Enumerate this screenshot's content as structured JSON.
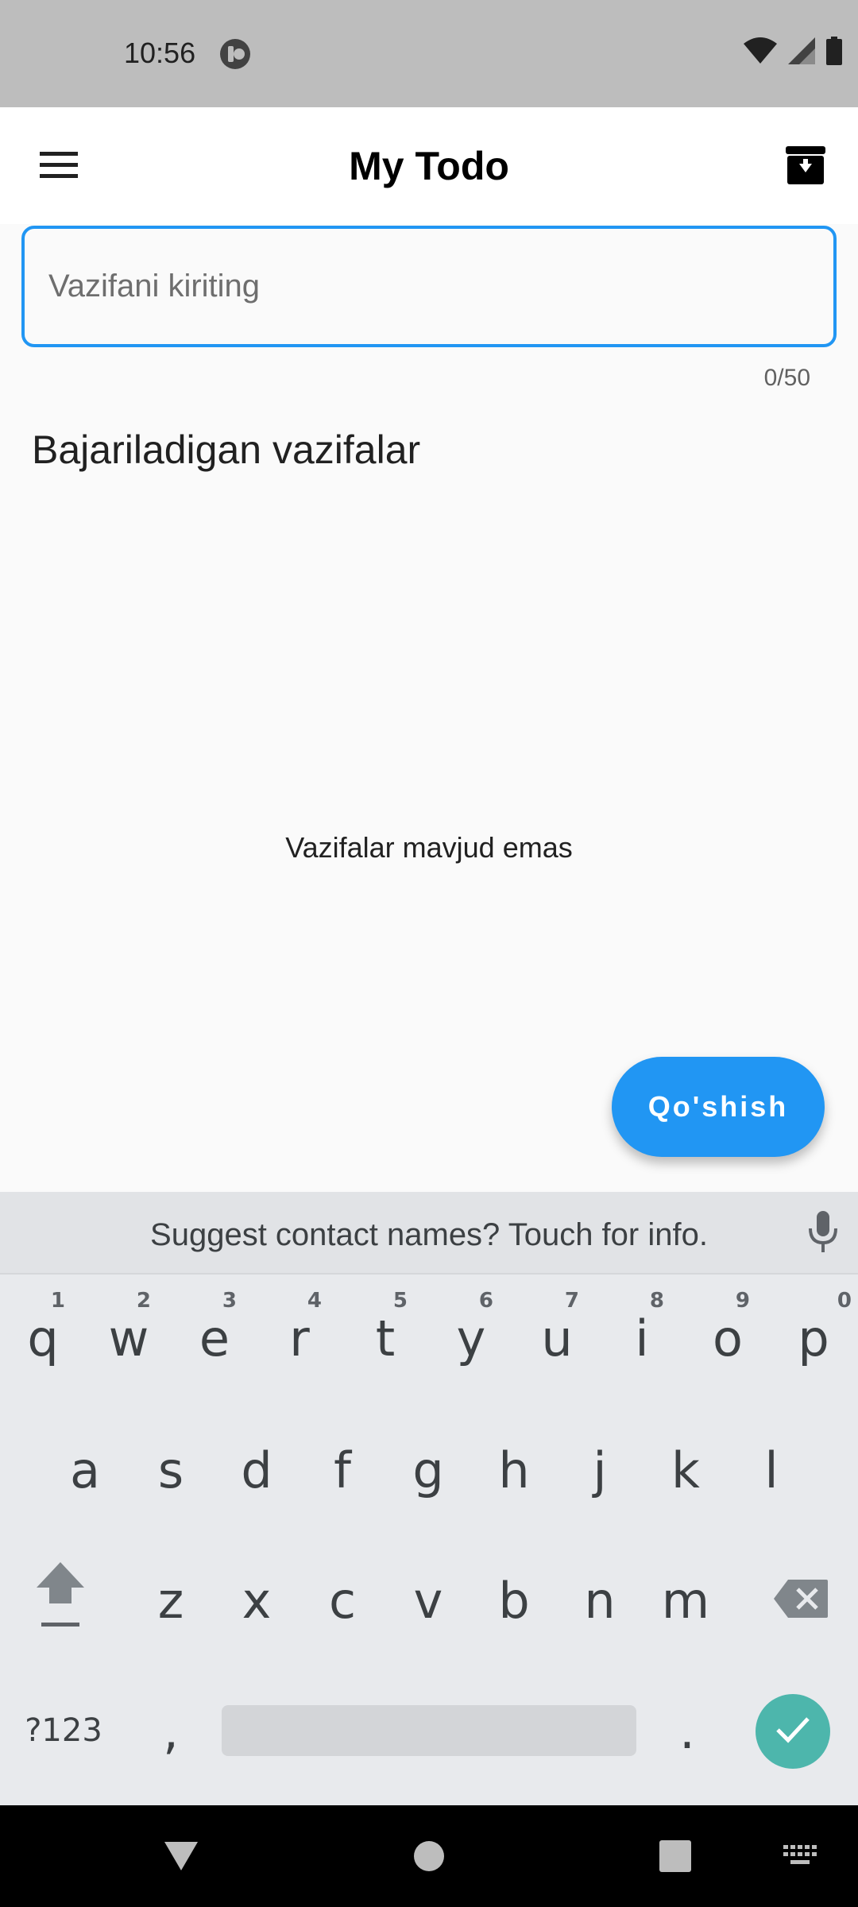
{
  "status_bar": {
    "time": "10:56"
  },
  "app_bar": {
    "title": "My Todo",
    "menu_icon": "menu-icon",
    "archive_icon": "archive-icon"
  },
  "task_input": {
    "placeholder": "Vazifani kiriting",
    "value": "",
    "counter": "0/50"
  },
  "section": {
    "title": "Bajariladigan vazifalar"
  },
  "empty_state": {
    "message": "Vazifalar mavjud emas"
  },
  "fab": {
    "label": "Qo'shish",
    "color": "#2196f3"
  },
  "keyboard": {
    "suggestion": "Suggest contact names? Touch for info.",
    "row1": [
      {
        "key": "q",
        "hint": "1"
      },
      {
        "key": "w",
        "hint": "2"
      },
      {
        "key": "e",
        "hint": "3"
      },
      {
        "key": "r",
        "hint": "4"
      },
      {
        "key": "t",
        "hint": "5"
      },
      {
        "key": "y",
        "hint": "6"
      },
      {
        "key": "u",
        "hint": "7"
      },
      {
        "key": "i",
        "hint": "8"
      },
      {
        "key": "o",
        "hint": "9"
      },
      {
        "key": "p",
        "hint": "0"
      }
    ],
    "row2": [
      "a",
      "s",
      "d",
      "f",
      "g",
      "h",
      "j",
      "k",
      "l"
    ],
    "row3": [
      "z",
      "x",
      "c",
      "v",
      "b",
      "n",
      "m"
    ],
    "symbols_label": "?123",
    "comma": ",",
    "period": ".",
    "enter_color": "#4db6ac"
  }
}
